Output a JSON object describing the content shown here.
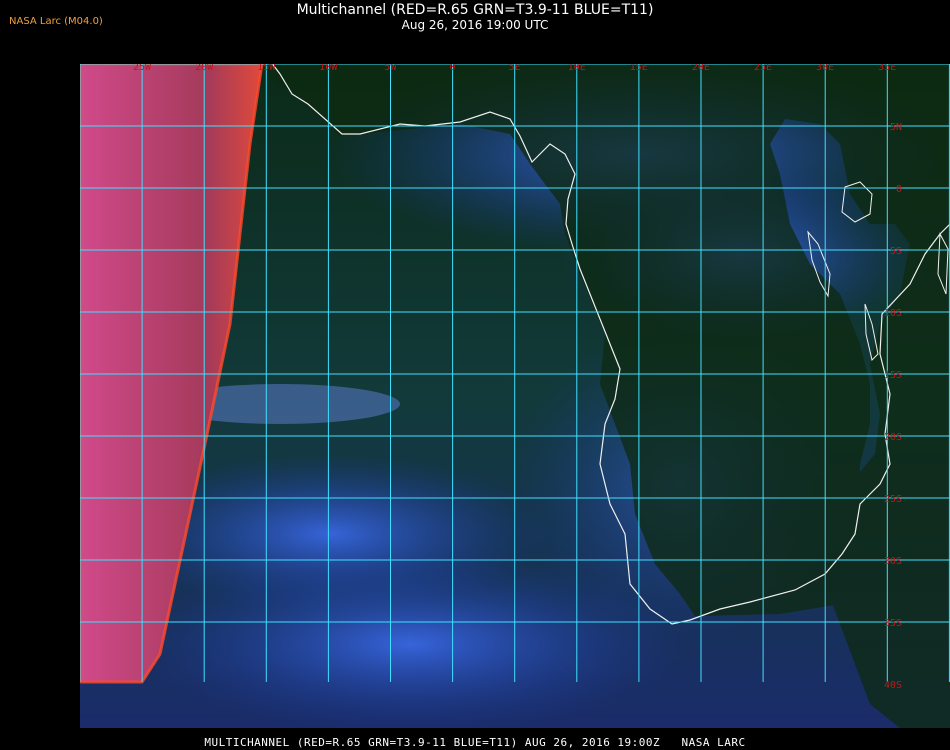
{
  "header": {
    "title": "Multichannel (RED=R.65 GRN=T3.9-11 BLUE=T11)",
    "datetime": "Aug 26, 2016 19:00 UTC",
    "tag": "NASA Larc (M04.0)"
  },
  "grid": {
    "lon_labels": [
      "25W",
      "20W",
      "15W",
      "10W",
      "5W",
      "0",
      "5E",
      "10E",
      "15E",
      "20E",
      "25E",
      "30E",
      "35E"
    ],
    "lat_labels": [
      "5N",
      "0",
      "5S",
      "10S",
      "15S",
      "20S",
      "25S",
      "30S",
      "35S",
      "40S"
    ]
  },
  "colors": {
    "grid": "#40e0ff",
    "label": "#c01818",
    "coast": "#f0f0f0",
    "ocean": "#123a3a",
    "land": "#0f2a0a",
    "old_image": "#c0306a"
  },
  "footer": {
    "text": "MULTICHANNEL (RED=R.65 GRN=T3.9-11 BLUE=T11) AUG 26, 2016 19:00Z   NASA LARC"
  }
}
